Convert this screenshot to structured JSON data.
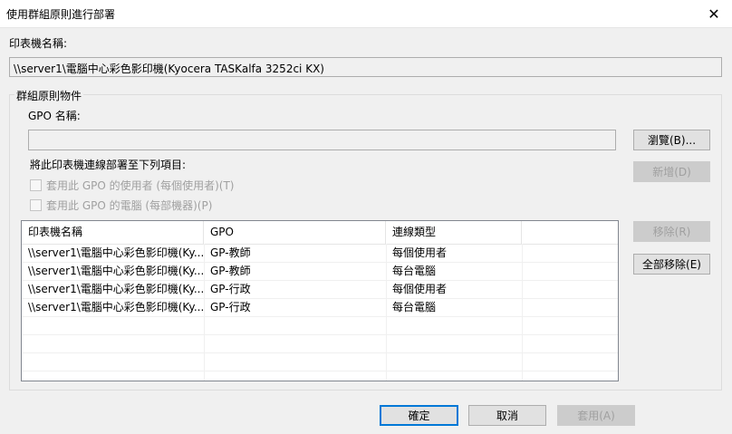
{
  "window": {
    "title": "使用群組原則進行部署",
    "close_glyph": "✕"
  },
  "printer_name_label": "印表機名稱:",
  "printer_name_value": "\\\\server1\\電腦中心彩色影印機(Kyocera TASKalfa 3252ci KX)",
  "group": {
    "legend": "群組原則物件",
    "gpo_name_label": "GPO 名稱:",
    "gpo_name_value": "",
    "browse_button": "瀏覽(B)...",
    "deploy_label": "將此印表機連線部署至下列項目:",
    "add_button": "新增(D)",
    "checkbox_users": "套用此 GPO 的使用者 (每個使用者)(T)",
    "checkbox_computers": "套用此 GPO 的電腦 (每部機器)(P)"
  },
  "list": {
    "columns": [
      "印表機名稱",
      "GPO",
      "連線類型"
    ],
    "rows": [
      [
        "\\\\server1\\電腦中心彩色影印機(Ky...",
        "GP-教師",
        "每個使用者"
      ],
      [
        "\\\\server1\\電腦中心彩色影印機(Ky...",
        "GP-教師",
        "每台電腦"
      ],
      [
        "\\\\server1\\電腦中心彩色影印機(Ky...",
        "GP-行政",
        "每個使用者"
      ],
      [
        "\\\\server1\\電腦中心彩色影印機(Ky...",
        "GP-行政",
        "每台電腦"
      ]
    ]
  },
  "side_buttons": {
    "remove": "移除(R)",
    "remove_all": "全部移除(E)"
  },
  "footer": {
    "ok": "確定",
    "cancel": "取消",
    "apply": "套用(A)"
  }
}
